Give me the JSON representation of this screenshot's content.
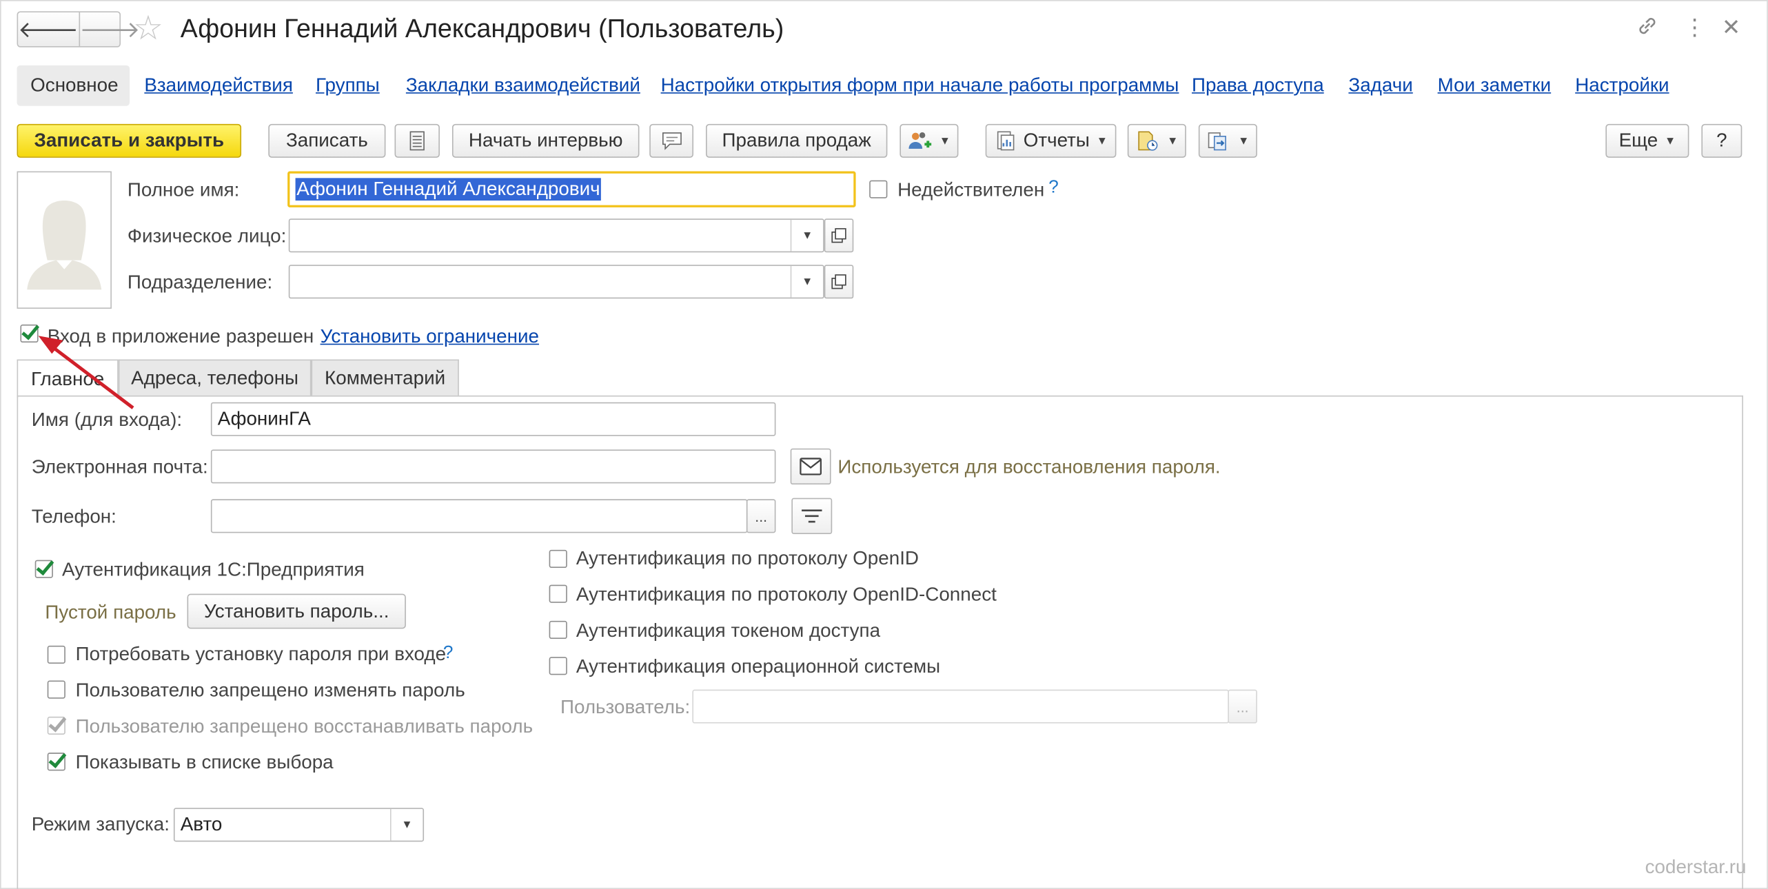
{
  "window": {
    "title": "Афонин Геннадий Александрович (Пользователь)",
    "back_icon": "arrow-left",
    "forward_icon": "arrow-right",
    "favorite_icon": "star",
    "link_icon": "link",
    "more_icon": "more-vertical",
    "close_icon": "close"
  },
  "nav_tabs": [
    "Основное",
    "Взаимодействия",
    "Группы",
    "Закладки взаимодействий",
    "Настройки открытия форм при начале работы программы",
    "Права доступа",
    "Задачи",
    "Мои заметки",
    "Настройки"
  ],
  "toolbar": {
    "save_close": "Записать и закрыть",
    "save": "Записать",
    "start_interview": "Начать интервью",
    "sales_rules": "Правила продаж",
    "reports": "Отчеты",
    "more": "Еще",
    "help": "?"
  },
  "form": {
    "full_name_label": "Полное имя:",
    "full_name_value": "Афонин Геннадий Александрович",
    "person_label": "Физическое лицо:",
    "person_value": "",
    "department_label": "Подразделение:",
    "department_value": "",
    "invalid_label": "Недействителен",
    "invalid_help": "?",
    "login_allowed_label": "Вход в приложение разрешен",
    "login_allowed_checked": true,
    "set_restriction_link": "Установить ограничение"
  },
  "inner_tabs": [
    "Главное",
    "Адреса, телефоны",
    "Комментарий"
  ],
  "main_tab": {
    "login_name_label": "Имя (для входа):",
    "login_name_value": "АфонинГА",
    "email_label": "Электронная почта:",
    "email_value": "",
    "email_hint": "Используется для восстановления пароля.",
    "phone_label": "Телефон:",
    "phone_value": "",
    "phone_ellipsis": "...",
    "auth_1c_label": "Аутентификация 1С:Предприятия",
    "empty_password": "Пустой пароль",
    "set_password_button": "Установить пароль...",
    "require_password_label": "Потребовать установку пароля при входе",
    "require_password_help": "?",
    "forbid_change_label": "Пользователю запрещено изменять пароль",
    "forbid_restore_label": "Пользователю запрещено восстанавливать пароль",
    "show_in_list_label": "Показывать в списке выбора",
    "auth_openid_label": "Аутентификация по протоколу OpenID",
    "auth_openid_connect_label": "Аутентификация по протоколу OpenID-Connect",
    "auth_token_label": "Аутентификация токеном доступа",
    "auth_os_label": "Аутентификация операционной системы",
    "os_user_label": "Пользователь:",
    "os_user_value": "",
    "os_user_ellipsis": "...",
    "launch_mode_label": "Режим запуска:",
    "launch_mode_value": "Авто"
  },
  "watermark": "coderstar.ru",
  "colors": {
    "primary_button": "#f5d80d",
    "link": "#0645ad",
    "check": "#1f8a3c",
    "annotation_arrow": "#d0202a",
    "hint": "#7a6f45"
  }
}
